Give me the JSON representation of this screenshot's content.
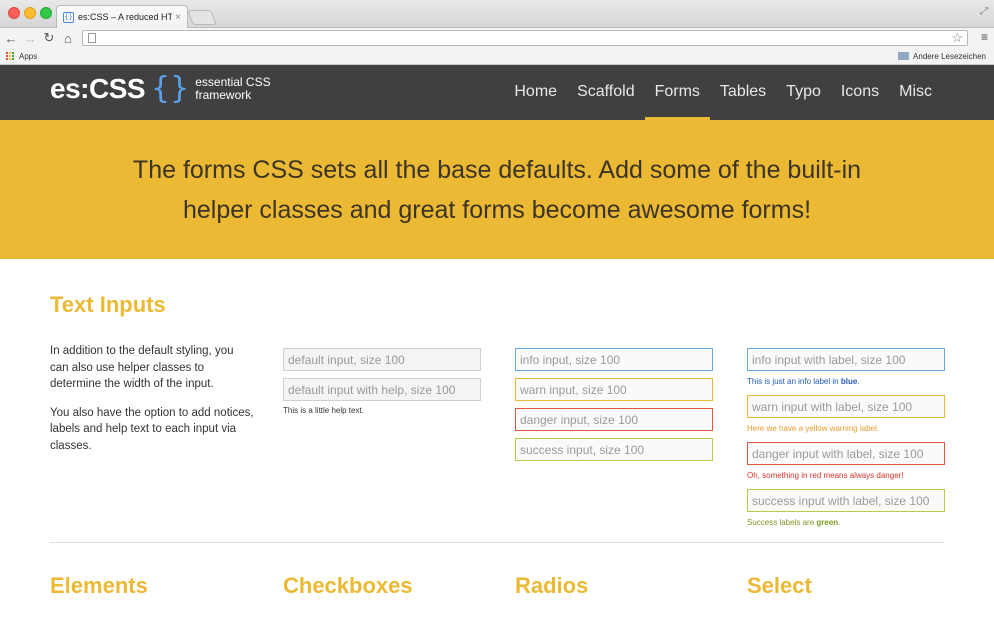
{
  "browser": {
    "tab_title": "es:CSS – A reduced HTML5",
    "favicon_text": "{}",
    "bookmarks_apps": "Apps",
    "bookmarks_other": "Andere Lesezeichen"
  },
  "header": {
    "logo_name": "es:CSS",
    "logo_brace": "{}",
    "logo_tagline_1": "essential CSS",
    "logo_tagline_2": "framework",
    "nav": [
      "Home",
      "Scaffold",
      "Forms",
      "Tables",
      "Typo",
      "Icons",
      "Misc"
    ],
    "active_nav": "Forms"
  },
  "hero": {
    "text": "The forms CSS sets all the base defaults. Add some of the built-in helper classes and great forms become awesome forms!"
  },
  "text_inputs": {
    "title": "Text Inputs",
    "intro_1": "In addition to the default styling, you can also use helper classes to determine the width of the input.",
    "intro_2": "You also have the option to add notices, labels and help text to each input via classes.",
    "col1": {
      "default_placeholder": "default input, size 100",
      "help_placeholder": "default input with help, size 100",
      "help_text": "This is a little help text."
    },
    "col2": {
      "info_placeholder": "info input, size 100",
      "warn_placeholder": "warn input, size 100",
      "danger_placeholder": "danger input, size 100",
      "success_placeholder": "success input, size 100"
    },
    "col3": {
      "info_placeholder": "info input with label, size 100",
      "info_label_pre": "This is just an info label in ",
      "info_label_bold": "blue",
      "info_label_post": ".",
      "warn_placeholder": "warn input with label, size 100",
      "warn_label": "Here we have a yellow warning label.",
      "danger_placeholder": "danger input with label, size 100",
      "danger_label": "Oh, something in red means always danger!",
      "success_placeholder": "success input with label, size 100",
      "success_label_pre": "Success labels are ",
      "success_label_bold": "green",
      "success_label_post": "."
    }
  },
  "sections": {
    "elements": "Elements",
    "checkboxes": "Checkboxes",
    "radios": "Radios",
    "select": "Select"
  },
  "colors": {
    "accent": "#ebb934",
    "header_bg": "#404040",
    "info": "#6aaae4",
    "danger": "#e0563f",
    "success": "#b2cf49"
  }
}
